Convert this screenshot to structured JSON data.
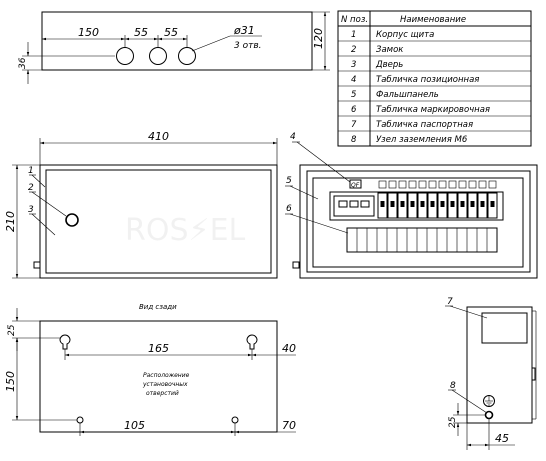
{
  "top_view": {
    "d150": "150",
    "d55a": "55",
    "d55b": "55",
    "d120": "120",
    "d36": "36",
    "hole_d": "ø31",
    "hole_count": "3 отв."
  },
  "front_view": {
    "d410": "410",
    "d210": "210",
    "c1": "1",
    "c2": "2",
    "c3": "3"
  },
  "inner_view": {
    "c4": "4",
    "c5": "5",
    "c6": "6",
    "breaker": "QF"
  },
  "back_view": {
    "title": "Вид сзади",
    "note_l1": "Расположение",
    "note_l2": "установочных",
    "note_l3": "отверстий",
    "d25": "25",
    "d150": "150",
    "d165": "165",
    "d40": "40",
    "d105": "105",
    "d70": "70"
  },
  "side_view": {
    "c7": "7",
    "c8": "8",
    "d25": "25",
    "d45": "45"
  },
  "parts_table": {
    "header_num": "N поз.",
    "header_name": "Наименование",
    "rows": [
      {
        "num": "1",
        "name": "Корпус щита"
      },
      {
        "num": "2",
        "name": "Замок"
      },
      {
        "num": "3",
        "name": "Дверь"
      },
      {
        "num": "4",
        "name": "Табличка позиционная"
      },
      {
        "num": "5",
        "name": "Фальшпанель"
      },
      {
        "num": "6",
        "name": "Табличка маркировочная"
      },
      {
        "num": "7",
        "name": "Табличка паспортная"
      },
      {
        "num": "8",
        "name": "Узел заземления М6"
      }
    ]
  },
  "watermark": "ROS⚡EL"
}
